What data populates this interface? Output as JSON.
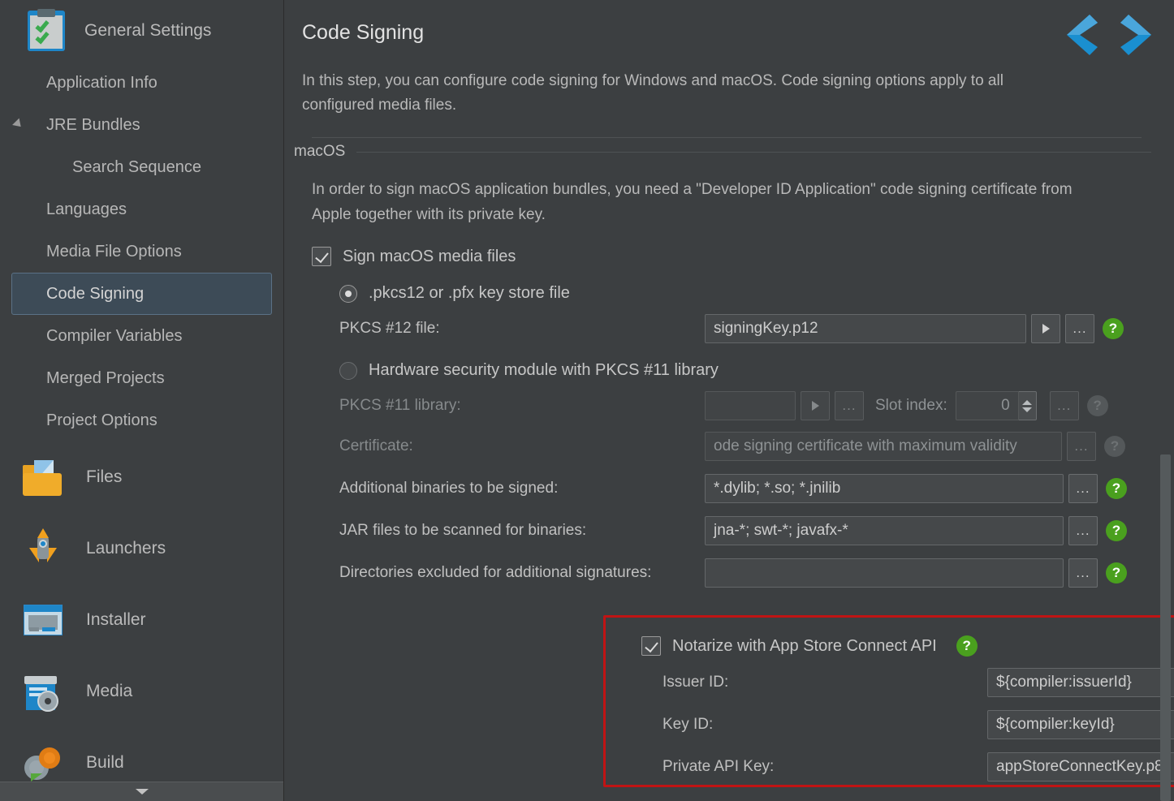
{
  "sidebar": {
    "header": {
      "label": "General Settings",
      "icon": "clipboard-check-icon"
    },
    "items": [
      {
        "label": "Application Info",
        "level": 1,
        "selected": false,
        "expander": false
      },
      {
        "label": "JRE Bundles",
        "level": 1,
        "selected": false,
        "expander": true
      },
      {
        "label": "Search Sequence",
        "level": 2,
        "selected": false,
        "expander": false
      },
      {
        "label": "Languages",
        "level": 1,
        "selected": false,
        "expander": false
      },
      {
        "label": "Media File Options",
        "level": 1,
        "selected": false,
        "expander": false
      },
      {
        "label": "Code Signing",
        "level": 1,
        "selected": true,
        "expander": false
      },
      {
        "label": "Compiler Variables",
        "level": 1,
        "selected": false,
        "expander": false
      },
      {
        "label": "Merged Projects",
        "level": 1,
        "selected": false,
        "expander": false
      },
      {
        "label": "Project Options",
        "level": 1,
        "selected": false,
        "expander": false
      }
    ],
    "sections": [
      {
        "label": "Files",
        "icon": "folder-icon"
      },
      {
        "label": "Launchers",
        "icon": "rocket-icon"
      },
      {
        "label": "Installer",
        "icon": "installer-window-icon"
      },
      {
        "label": "Media",
        "icon": "media-disc-icon"
      },
      {
        "label": "Build",
        "icon": "gears-icon"
      }
    ]
  },
  "header": {
    "title": "Code Signing",
    "description": "In this step, you can configure code signing for Windows and macOS. Code signing options apply to all configured media files.",
    "prev_icon": "chevron-left-icon",
    "next_icon": "chevron-right-icon"
  },
  "macos": {
    "legend": "macOS",
    "description": "In order to sign macOS application bundles, you need a \"Developer ID Application\" code signing certificate from Apple together with its private key.",
    "sign_checkbox": {
      "label": "Sign macOS media files",
      "checked": true
    },
    "radio_pkcs12": {
      "label": ".pkcs12 or .pfx key store file",
      "selected": true
    },
    "radio_hsm": {
      "label": "Hardware security module with PKCS #11 library",
      "selected": false
    },
    "fields": {
      "pkcs12_file": {
        "label": "PKCS #12 file:",
        "value": "signingKey.p12",
        "enabled": true
      },
      "pkcs11_library": {
        "label": "PKCS #11 library:",
        "value": "",
        "enabled": false
      },
      "slot_index": {
        "label": "Slot index:",
        "value": "0",
        "enabled": false
      },
      "certificate": {
        "label": "Certificate:",
        "value": "ode signing certificate with maximum validity",
        "enabled": false
      },
      "additional_binaries": {
        "label": "Additional binaries to be signed:",
        "value": "*.dylib; *.so; *.jnilib",
        "enabled": true
      },
      "jar_files": {
        "label": "JAR files to be scanned for binaries:",
        "value": "jna-*; swt-*; javafx-*",
        "enabled": true
      },
      "excluded_dirs": {
        "label": "Directories excluded for additional signatures:",
        "value": "",
        "enabled": true
      }
    }
  },
  "notarize": {
    "checkbox": {
      "label": "Notarize with App Store Connect API",
      "checked": true
    },
    "fields": {
      "issuer_id": {
        "label": "Issuer ID:",
        "value": "${compiler:issuerId}"
      },
      "key_id": {
        "label": "Key ID:",
        "value": "${compiler:keyId}"
      },
      "private_api_key": {
        "label": "Private API Key:",
        "value": "appStoreConnectKey.p8"
      }
    },
    "highlight_color": "#c01414"
  },
  "icons": {
    "help": "?",
    "browse": "...",
    "dropdown": "play-triangle"
  },
  "colors": {
    "background": "#3c3f41",
    "selected": "#3d4b57",
    "accent": "#1e86c8",
    "help_green": "#4aa01e",
    "highlight_red": "#c01414"
  }
}
